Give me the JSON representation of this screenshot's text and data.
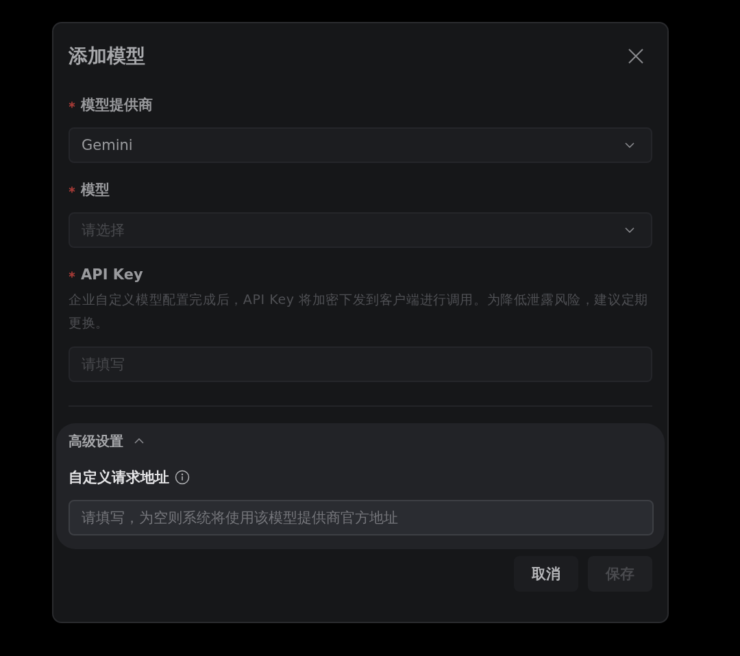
{
  "dialog": {
    "title": "添加模型",
    "fields": [
      {
        "kind": "select",
        "label": "模型提供商",
        "required": true,
        "value": "Gemini"
      },
      {
        "kind": "select",
        "label": "模型",
        "required": true,
        "placeholder": "请选择"
      },
      {
        "kind": "input",
        "label": "API Key",
        "required": true,
        "description": "企业自定义模型配置完成后，API Key 将加密下发到客户端进行调用。为降低泄露风险，建议定期更换。",
        "placeholder": "请填写"
      }
    ],
    "advanced": {
      "label": "高级设置",
      "expanded": true,
      "fields": [
        {
          "kind": "input",
          "label": "自定义请求地址",
          "info": true,
          "placeholder": "请填写，为空则系统将使用该模型提供商官方地址"
        }
      ]
    },
    "buttons": [
      {
        "label": "取消",
        "disabled": false
      },
      {
        "label": "保存",
        "disabled": true
      }
    ]
  }
}
